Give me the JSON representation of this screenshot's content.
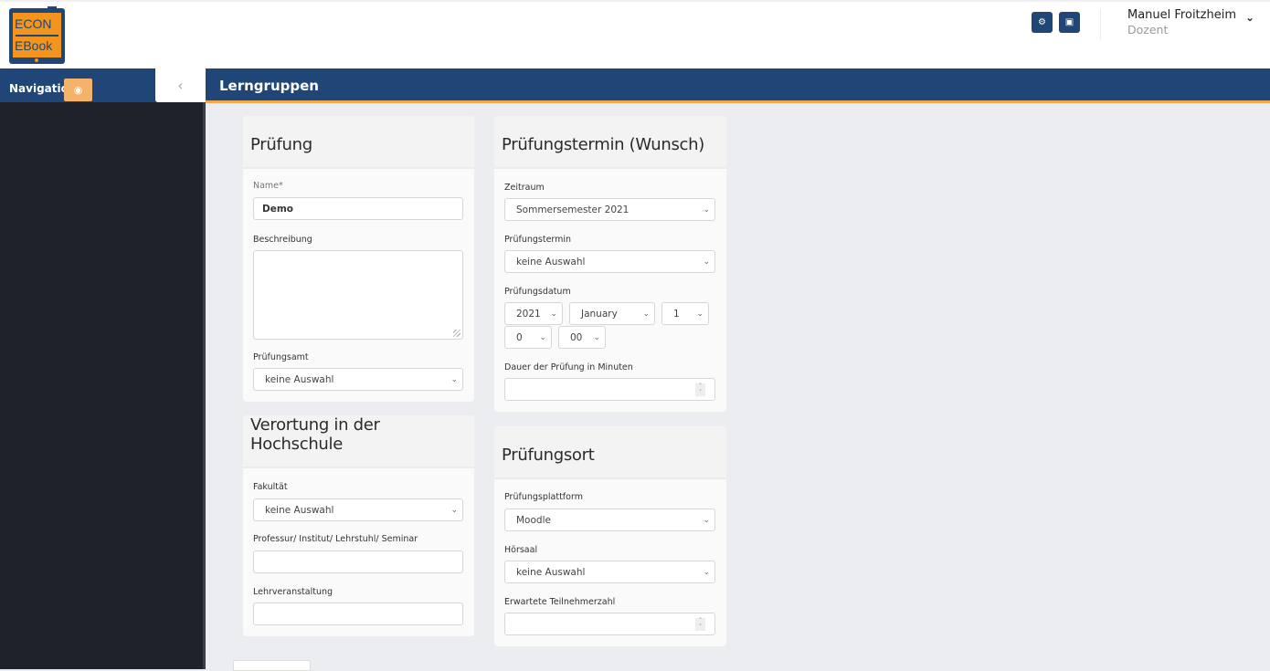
{
  "app": {
    "logo": {
      "line1": "ECON",
      "line2": "EBook"
    },
    "header_icons": [
      {
        "name": "briefcase-settings-icon",
        "glyph": "⚙"
      },
      {
        "name": "report-icon",
        "glyph": "▣"
      }
    ],
    "user": {
      "name": "Manuel Froitzheim",
      "role": "Dozent",
      "caret": "⌄"
    }
  },
  "nav": {
    "label": "Navigation",
    "eye_icon": "◉",
    "collapse_icon": "‹"
  },
  "page": {
    "title": "Lerngruppen"
  },
  "colors": {
    "primary": "#1f4677",
    "accent": "#f3941d",
    "sidebar": "#1e222b"
  },
  "cards": {
    "pruefung": {
      "title": "Prüfung",
      "name_label": "Name*",
      "name_value": "Demo",
      "beschreibung_label": "Beschreibung",
      "beschreibung_value": "",
      "pruefungsamt_label": "Prüfungsamt",
      "pruefungsamt_value": "keine Auswahl"
    },
    "verortung": {
      "title": "Verortung in der Hochschule",
      "fakultaet_label": "Fakultät",
      "fakultaet_value": "keine Auswahl",
      "professur_label": "Professur/ Institut/ Lehrstuhl/ Seminar",
      "professur_value": "",
      "lehrveranstaltung_label": "Lehrveranstaltung",
      "lehrveranstaltung_value": ""
    },
    "termin": {
      "title": "Prüfungstermin (Wunsch)",
      "zeitraum_label": "Zeitraum",
      "zeitraum_value": "Sommersemester 2021",
      "pruefungstermin_label": "Prüfungstermin",
      "pruefungstermin_value": "keine Auswahl",
      "datum_label": "Prüfungsdatum",
      "year": "2021",
      "month": "January",
      "day": "1",
      "hour": "0",
      "minute": "00",
      "dauer_label": "Dauer der Prüfung in Minuten",
      "dauer_value": ""
    },
    "ort": {
      "title": "Prüfungsort",
      "plattform_label": "Prüfungsplattform",
      "plattform_value": "Moodle",
      "hoersaal_label": "Hörsaal",
      "hoersaal_value": "keine Auswahl",
      "teilnehmer_label": "Erwartete Teilnehmerzahl",
      "teilnehmer_value": ""
    }
  },
  "icons": {
    "chevron": "⌄",
    "spinner_up": "˄",
    "spinner_down": "˅"
  }
}
